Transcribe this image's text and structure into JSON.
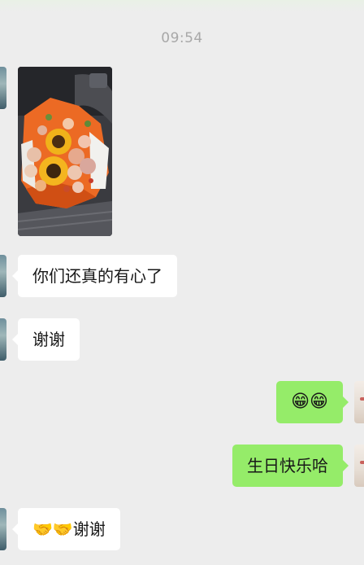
{
  "chat": {
    "timestamp": "09:54",
    "messages": [
      {
        "side": "left",
        "type": "image",
        "alt": "flower-bouquet-photo"
      },
      {
        "side": "left",
        "type": "text",
        "text": "你们还真的有心了"
      },
      {
        "side": "left",
        "type": "text",
        "text": "谢谢"
      },
      {
        "side": "right",
        "type": "text",
        "text": "😁😁"
      },
      {
        "side": "right",
        "type": "text",
        "text": "生日快乐哈"
      },
      {
        "side": "left",
        "type": "text",
        "text": "🤝🤝谢谢"
      }
    ]
  },
  "colors": {
    "background": "#ededed",
    "incoming_bubble": "#ffffff",
    "outgoing_bubble": "#95ec69",
    "timestamp": "#a8a8a8"
  }
}
